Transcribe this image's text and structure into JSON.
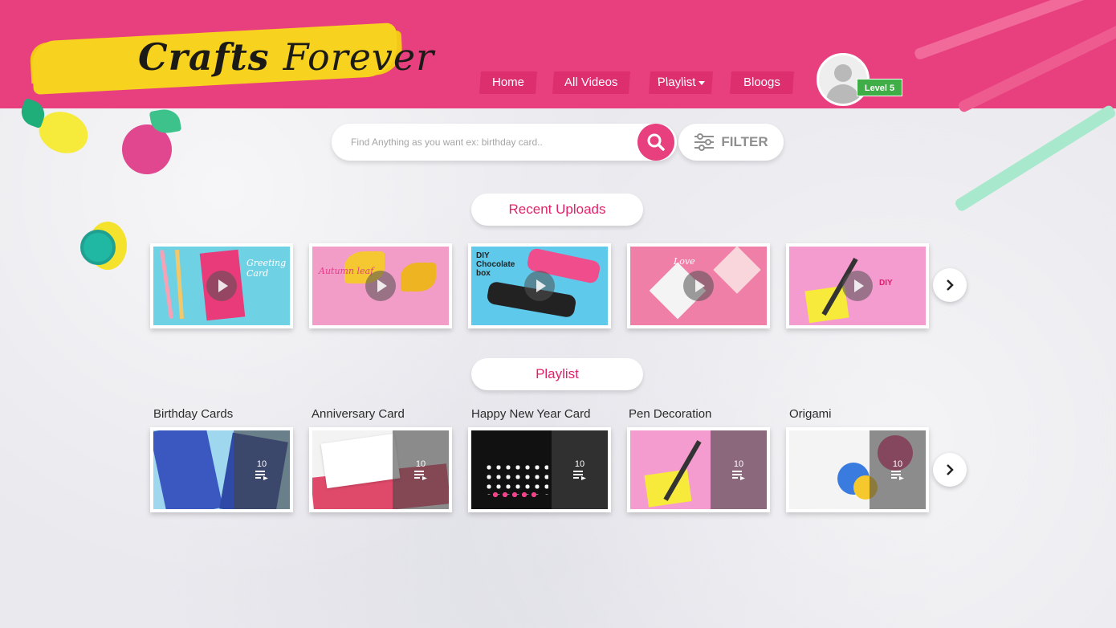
{
  "brand": {
    "name_first": "Crafts",
    "name_second": "Forever"
  },
  "nav": {
    "items": [
      {
        "label": "Home"
      },
      {
        "label": "All Videos"
      },
      {
        "label": "Playlist"
      },
      {
        "label": "Bloogs"
      }
    ]
  },
  "user": {
    "level": "Level 5"
  },
  "search": {
    "placeholder": "Find Anything as you want ex: birthday card..",
    "filter_label": "FILTER"
  },
  "sections": {
    "recent_title": "Recent Uploads",
    "playlist_title": "Playlist"
  },
  "recent_uploads": [
    {
      "thumb_text": "Greeting Card",
      "bg": "#6fd2e4"
    },
    {
      "thumb_text": "Autumn leaf",
      "bg": "#f29cc8"
    },
    {
      "thumb_text": "DIY Chocolate box",
      "bg": "#5ec9ea"
    },
    {
      "thumb_text": "Love",
      "bg": "#f07fa8"
    },
    {
      "thumb_text": "DIY",
      "bg": "#f49bd0"
    }
  ],
  "playlists": [
    {
      "title": "Birthday Cards",
      "count": "10",
      "bg": "#3a58c0"
    },
    {
      "title": "Anniversary Card",
      "count": "10",
      "bg": "#e04a6a"
    },
    {
      "title": "Happy New Year Card",
      "count": "10",
      "bg": "#111111"
    },
    {
      "title": "Pen Decoration",
      "count": "10",
      "bg": "#f49bd0"
    },
    {
      "title": "Origami",
      "count": "10",
      "bg": "#f4f4f4"
    }
  ],
  "colors": {
    "brand_pink": "#e8407f",
    "logo_yellow": "#f7d21e",
    "badge_green": "#3fae47"
  }
}
